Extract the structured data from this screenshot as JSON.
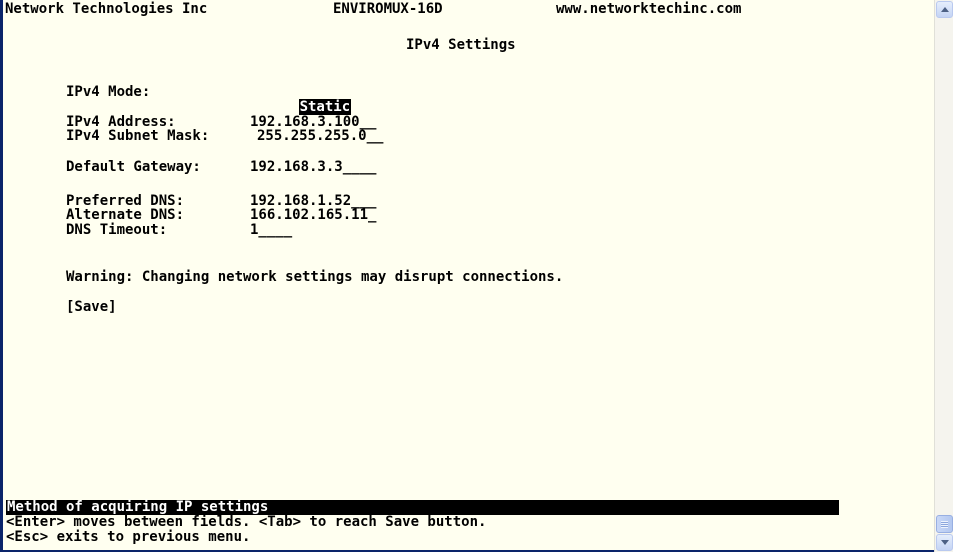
{
  "header": {
    "vendor": "Network Technologies Inc",
    "model": "ENVIROMUX-16D",
    "website": "www.networktechinc.com"
  },
  "page_title": "IPv4 Settings",
  "fields": {
    "ipv4_mode": {
      "label": "IPv4 Mode:",
      "value": "Static"
    },
    "ipv4_address": {
      "label": "IPv4 Address:",
      "value": "192.168.3.100__"
    },
    "subnet_mask": {
      "label": "IPv4 Subnet Mask:",
      "value": "255.255.255.0__"
    },
    "default_gateway": {
      "label": "Default Gateway:",
      "value": "192.168.3.3____"
    },
    "preferred_dns": {
      "label": "Preferred DNS:",
      "value": "192.168.1.52___"
    },
    "alternate_dns": {
      "label": "Alternate DNS:",
      "value": "166.102.165.11_"
    },
    "dns_timeout": {
      "label": "DNS Timeout:",
      "value": "1____"
    }
  },
  "warning": "Warning: Changing network settings may disrupt connections.",
  "save_button": "[Save]",
  "status": {
    "help": "Method of acquiring IP settings",
    "hint1": "<Enter> moves between fields. <Tab> to reach Save button.",
    "hint2": "<Esc> exits to previous menu."
  },
  "scrollbar": {
    "up_icon": "arrow-up-icon",
    "down_icon": "arrow-down-icon"
  }
}
